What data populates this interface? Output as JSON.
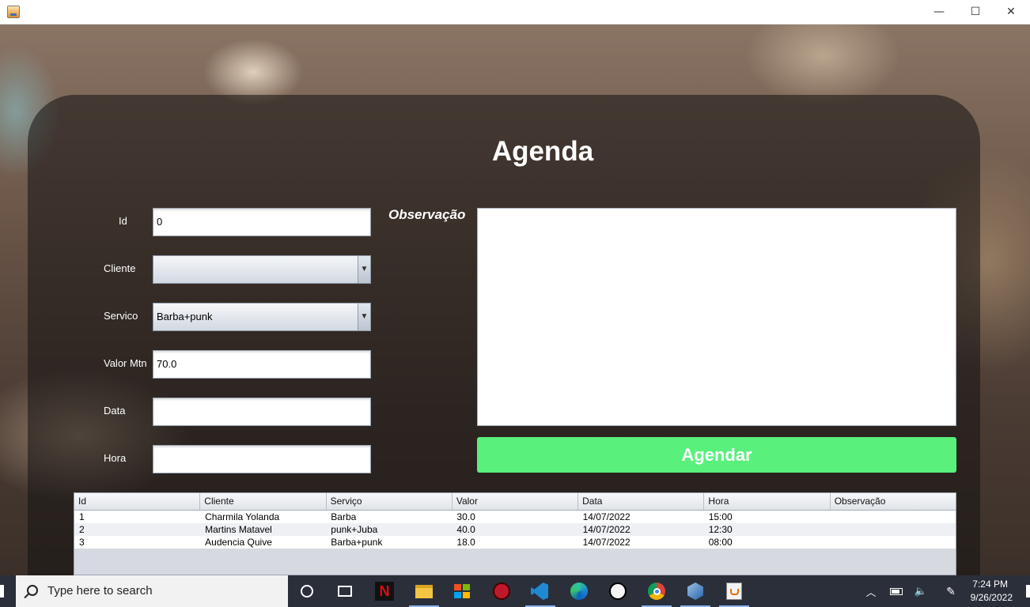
{
  "window": {
    "minimize": "—",
    "maximize": "☐",
    "close": "✕"
  },
  "form": {
    "title": "Agenda",
    "labels": {
      "id": "Id",
      "cliente": "Cliente",
      "servico": "Servico",
      "valor": "Valor Mtn",
      "data": "Data",
      "hora": "Hora",
      "observacao": "Observação"
    },
    "values": {
      "id": "0",
      "cliente": "",
      "servico": "Barba+punk",
      "valor": "70.0",
      "data": "",
      "hora": "",
      "observacao": ""
    },
    "submit_label": "Agendar"
  },
  "table": {
    "columns": [
      "Id",
      "Cliente",
      "Serviço",
      "Valor",
      "Data",
      "Hora",
      "Observação"
    ],
    "rows": [
      [
        "1",
        "Charmila Yolanda",
        "Barba",
        "30.0",
        "14/07/2022",
        "15:00",
        ""
      ],
      [
        "2",
        "Martins Matavel",
        "punk+Juba",
        "40.0",
        "14/07/2022",
        "12:30",
        ""
      ],
      [
        "3",
        "Audencia Quive",
        "Barba+punk",
        "18.0",
        "14/07/2022",
        "08:00",
        ""
      ]
    ]
  },
  "taskbar": {
    "search_placeholder": "Type here to search",
    "time": "7:24 PM",
    "date": "9/26/2022",
    "apps": [
      "cortana-icon",
      "task-view-icon",
      "netflix-icon",
      "file-explorer-icon",
      "microsoft-store-icon",
      "game-app-icon",
      "vscode-icon",
      "edge-icon",
      "inkscape-icon",
      "chrome-icon",
      "virtualbox-icon",
      "java-app-icon"
    ]
  },
  "colors": {
    "accent_button": "#59f07c",
    "panel_overlay": "rgba(20,18,18,0.55)"
  }
}
